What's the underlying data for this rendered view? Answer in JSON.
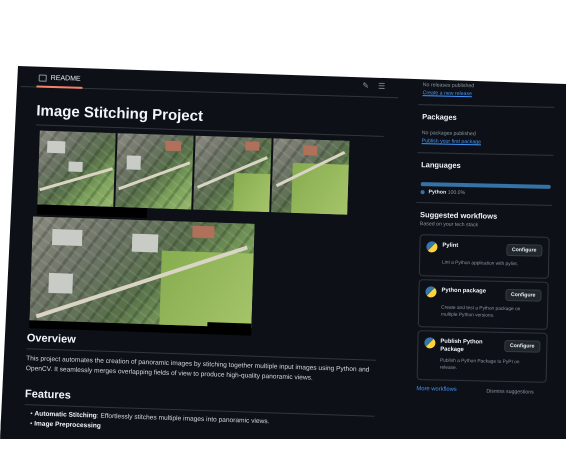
{
  "readme_tab": {
    "label": "README"
  },
  "readme": {
    "title": "Image Stitching Project",
    "overview_heading": "Overview",
    "overview_text": "This project automates the creation of panoramic images by stitching together multiple input images using Python and OpenCV. It seamlessly merges overlapping fields of view to produce high-quality panoramic views.",
    "features_heading": "Features",
    "features": [
      {
        "name": "Automatic Stitching",
        "desc": "Effortlessly stitches multiple images into panoramic views."
      },
      {
        "name": "Image Preprocessing",
        "desc": ""
      }
    ]
  },
  "sidebar": {
    "releases": {
      "empty": "No releases published",
      "link": "Create a new release"
    },
    "packages": {
      "title": "Packages",
      "empty": "No packages published",
      "link": "Publish your first package"
    },
    "languages": {
      "title": "Languages",
      "items": [
        {
          "name": "Python",
          "percent": "100.0%",
          "color": "#3572A5"
        }
      ]
    },
    "workflows": {
      "title": "Suggested workflows",
      "subtitle": "Based on your tech stack",
      "cards": [
        {
          "name": "Pylint",
          "desc": "Lint a Python application with pylint.",
          "button": "Configure"
        },
        {
          "name": "Python package",
          "desc": "Create and test a Python package on multiple Python versions.",
          "button": "Configure"
        },
        {
          "name": "Publish Python Package",
          "desc": "Publish a Python Package to PyPI on release.",
          "button": "Configure"
        }
      ],
      "more": "More workflows",
      "dismiss": "Dismiss suggestions"
    }
  },
  "colors": {
    "accent": "#4493f8",
    "background": "#0d1117",
    "border": "#30363d",
    "python": "#3572A5"
  }
}
